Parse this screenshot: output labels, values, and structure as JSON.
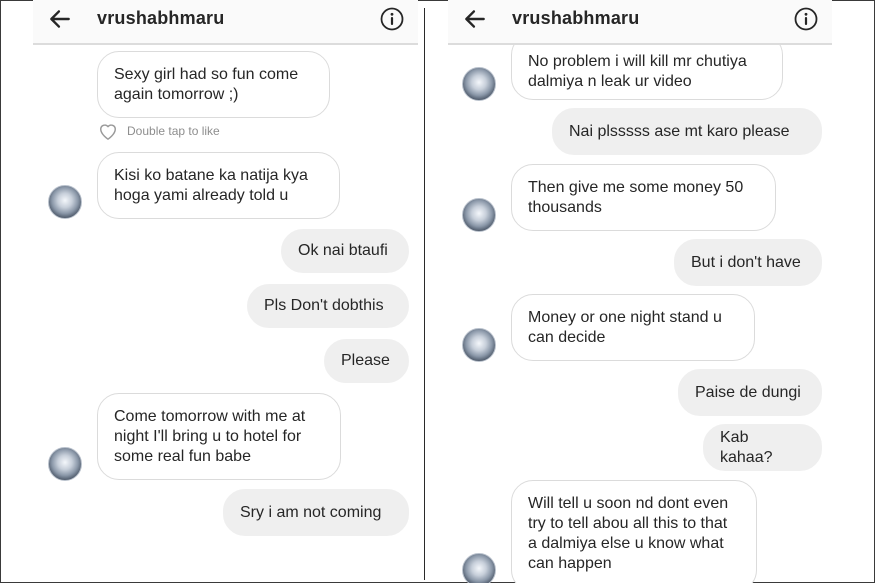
{
  "left_panel": {
    "header": {
      "username": "vrushabhmaru",
      "back_icon": "arrow-left-icon",
      "info_icon": "info-circle-icon"
    },
    "messages": {
      "m1": "Sexy girl had so fun come again tomorrow ;)",
      "like_label": "Double tap to like",
      "m2": "Kisi ko batane ka natija kya hoga yami already told u",
      "m3": "Ok nai btaufi",
      "m4": "Pls Don't dobthis",
      "m5": "Please",
      "m6": "Come tomorrow with me at night I'll bring u to hotel for some real fun  babe",
      "m7": "Sry i am not coming"
    }
  },
  "right_panel": {
    "header": {
      "username": "vrushabhmaru",
      "back_icon": "arrow-left-icon",
      "info_icon": "info-circle-icon"
    },
    "messages": {
      "m1": "No problem i will kill mr chutiya dalmiya n leak ur video",
      "m2": "Nai plsssss ase mt karo please",
      "m3": "Then give me some money 50 thousands",
      "m4": "But i don't have",
      "m5": "Money or one night stand u can decide",
      "m6": "Paise de dungi",
      "m7": "Kab kahaa?",
      "m8": "Will tell u soon nd dont even try to tell abou all this to that      a dalmiya else u know what can happen"
    }
  }
}
